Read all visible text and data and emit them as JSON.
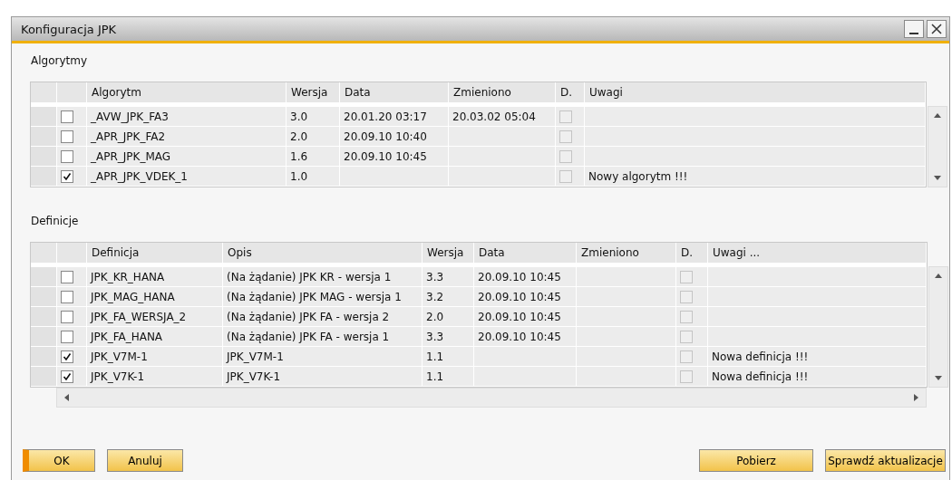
{
  "window": {
    "title": "Konfiguracja JPK"
  },
  "algorithms": {
    "label": "Algorytmy",
    "columns": [
      "Algorytm",
      "Wersja",
      "Data",
      "Zmieniono",
      "D.",
      "Uwagi"
    ],
    "rows": [
      {
        "checked": false,
        "name": "_AVW_JPK_FA3",
        "version": "3.0",
        "date": "20.01.20 03:17",
        "changed": "20.03.02 05:04",
        "d": false
      },
      {
        "checked": false,
        "name": "_APR_JPK_FA2",
        "version": "2.0",
        "date": "20.09.10 10:40",
        "d": false
      },
      {
        "checked": false,
        "name": "_APR_JPK_MAG",
        "version": "1.6",
        "date": "20.09.10 10:45",
        "d": false
      },
      {
        "checked": true,
        "name": "_APR_JPK_VDEK_1",
        "version": "1.0",
        "d": false,
        "notes": "Nowy algorytm !!!"
      }
    ]
  },
  "definitions": {
    "label": "Definicje",
    "columns": [
      "Definicja",
      "Opis",
      "Wersja",
      "Data",
      "Zmieniono",
      "D.",
      "Uwagi ..."
    ],
    "rows": [
      {
        "checked": false,
        "name": "JPK_KR_HANA",
        "description": "(Na żądanie) JPK KR - wersja 1",
        "version": "3.3",
        "date": "20.09.10 10:45",
        "d": false
      },
      {
        "checked": false,
        "name": "JPK_MAG_HANA",
        "description": "(Na żądanie) JPK MAG - wersja 1",
        "version": "3.2",
        "date": "20.09.10 10:45",
        "d": false
      },
      {
        "checked": false,
        "name": "JPK_FA_WERSJA_2",
        "description": "(Na żądanie) JPK FA - wersja 2",
        "version": "2.0",
        "date": "20.09.10 10:45",
        "d": false
      },
      {
        "checked": false,
        "name": "JPK_FA_HANA",
        "description": "(Na żądanie) JPK FA - wersja 1",
        "version": "3.3",
        "date": "20.09.10 10:45",
        "d": false
      },
      {
        "checked": true,
        "name": "JPK_V7M-1",
        "description": "JPK_V7M-1",
        "version": "1.1",
        "d": false,
        "notes": "Nowa definicja !!!"
      },
      {
        "checked": true,
        "name": "JPK_V7K-1",
        "description": "JPK_V7K-1",
        "version": "1.1",
        "d": false,
        "notes": "Nowa definicja !!!"
      }
    ]
  },
  "buttons": [
    {
      "label": "OK",
      "kind": "default"
    },
    {
      "label": "Anuluj",
      "kind": "normal"
    },
    {
      "label": "Pobierz",
      "kind": "normal"
    },
    {
      "label": "Sprawdź aktualizacje",
      "kind": "normal"
    }
  ]
}
